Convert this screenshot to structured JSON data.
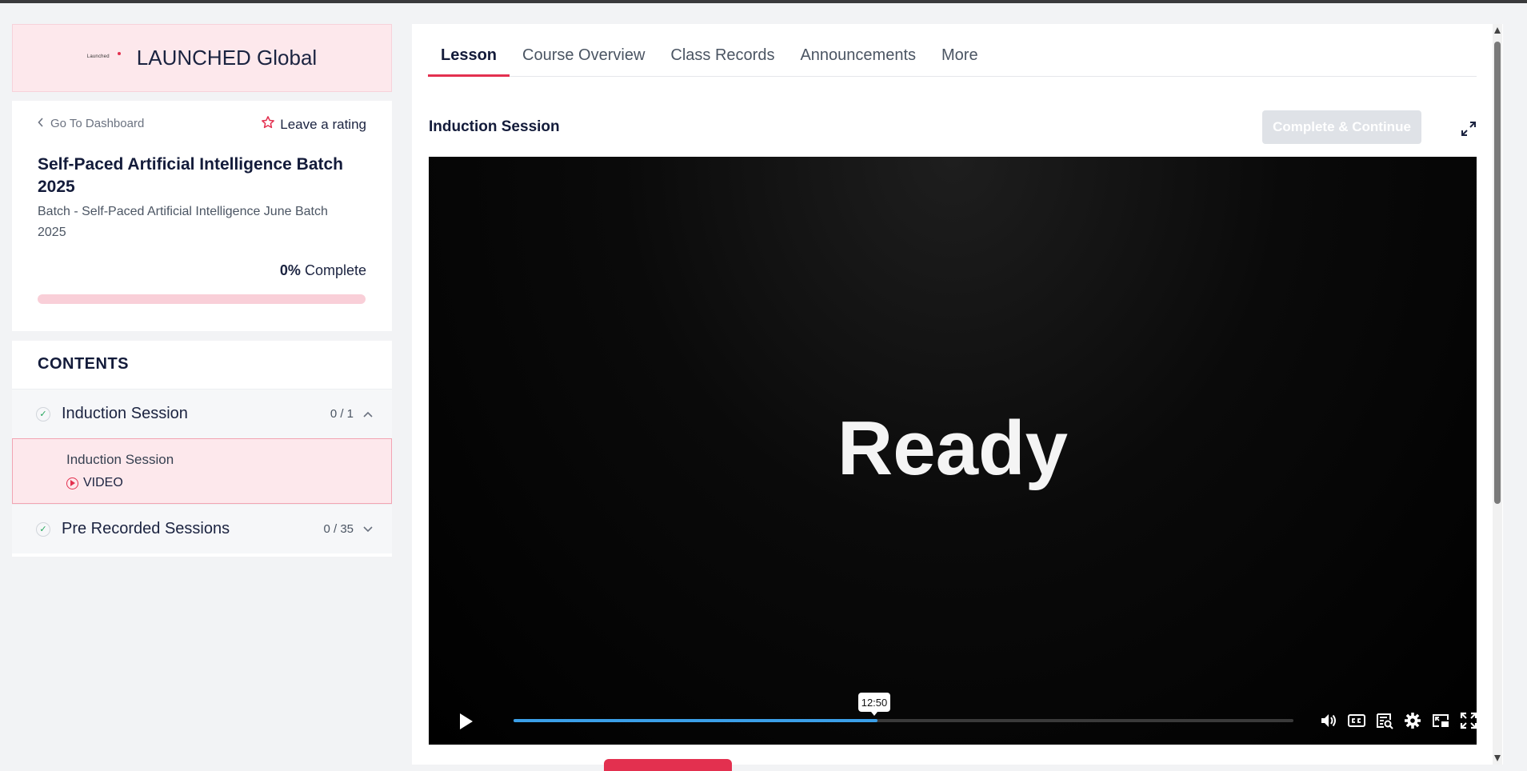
{
  "brand": {
    "name": "LAUNCHED Global",
    "logo_text": "Launched"
  },
  "sidebar": {
    "back_label": "Go To Dashboard",
    "rating_label": "Leave a rating",
    "course_title": "Self-Paced Artificial Intelligence Batch 2025",
    "course_subtitle": "Batch - Self-Paced Artificial Intelligence June Batch 2025",
    "progress_percent": "0%",
    "progress_suffix": "Complete",
    "progress_value": 0,
    "contents_heading": "CONTENTS",
    "sections": [
      {
        "title": "Induction Session",
        "count": "0 / 1",
        "expanded": true,
        "lessons": [
          {
            "title": "Induction Session",
            "type": "VIDEO"
          }
        ]
      },
      {
        "title": "Pre Recorded Sessions",
        "count": "0 / 35",
        "expanded": false
      }
    ]
  },
  "tabs": [
    "Lesson",
    "Course Overview",
    "Class Records",
    "Announcements",
    "More"
  ],
  "active_tab": "Lesson",
  "lesson": {
    "title": "Induction Session",
    "complete_button": "Complete & Continue"
  },
  "player": {
    "screen_text": "Ready",
    "hover_time": "12:50",
    "played_fraction": 0.467
  },
  "colors": {
    "accent": "#e3304f",
    "seek": "#3b9fe8",
    "brand_bg": "#fde8ec"
  }
}
